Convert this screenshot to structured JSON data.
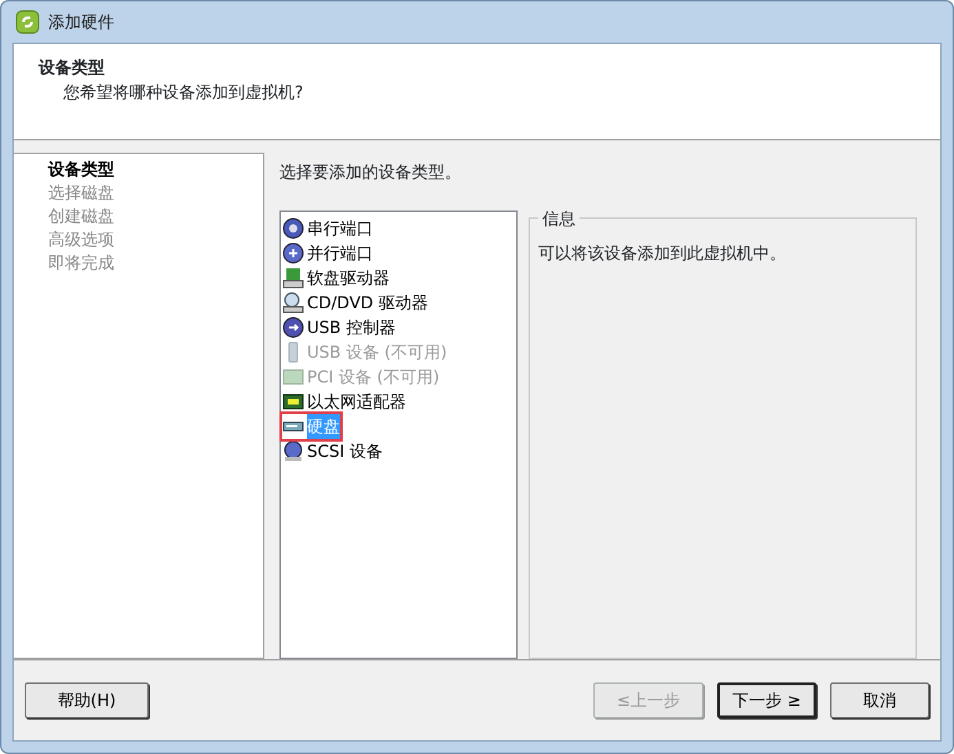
{
  "window": {
    "title": "添加硬件"
  },
  "header": {
    "title": "设备类型",
    "subtitle": "您希望将哪种设备添加到虚拟机?"
  },
  "steps": [
    {
      "label": "设备类型",
      "selected": true
    },
    {
      "label": "选择磁盘",
      "selected": false
    },
    {
      "label": "创建磁盘",
      "selected": false
    },
    {
      "label": "高级选项",
      "selected": false
    },
    {
      "label": "即将完成",
      "selected": false
    }
  ],
  "prompt": "选择要添加的设备类型。",
  "devices": [
    {
      "label": "串行端口",
      "kind": "serial",
      "disabled": false,
      "selected": false
    },
    {
      "label": "并行端口",
      "kind": "parallel",
      "disabled": false,
      "selected": false
    },
    {
      "label": "软盘驱动器",
      "kind": "floppy",
      "disabled": false,
      "selected": false
    },
    {
      "label": "CD/DVD 驱动器",
      "kind": "cdrom",
      "disabled": false,
      "selected": false
    },
    {
      "label": "USB 控制器",
      "kind": "usb",
      "disabled": false,
      "selected": false
    },
    {
      "label": "USB 设备 (不可用)",
      "kind": "usbdev",
      "disabled": true,
      "selected": false
    },
    {
      "label": "PCI 设备 (不可用)",
      "kind": "pci",
      "disabled": true,
      "selected": false
    },
    {
      "label": "以太网适配器",
      "kind": "ethernet",
      "disabled": false,
      "selected": false
    },
    {
      "label": "硬盘",
      "kind": "harddisk",
      "disabled": false,
      "selected": true
    },
    {
      "label": "SCSI 设备",
      "kind": "scsi",
      "disabled": false,
      "selected": false
    }
  ],
  "info": {
    "title": "信息",
    "text": "可以将该设备添加到此虚拟机中。"
  },
  "buttons": [
    {
      "label": "帮助(H)",
      "disabled": false,
      "default": false
    },
    {
      "label": "≤上一步",
      "disabled": true,
      "default": false
    },
    {
      "label": "下一步 ≥",
      "disabled": false,
      "default": true
    },
    {
      "label": "取消",
      "disabled": false,
      "default": false
    }
  ]
}
